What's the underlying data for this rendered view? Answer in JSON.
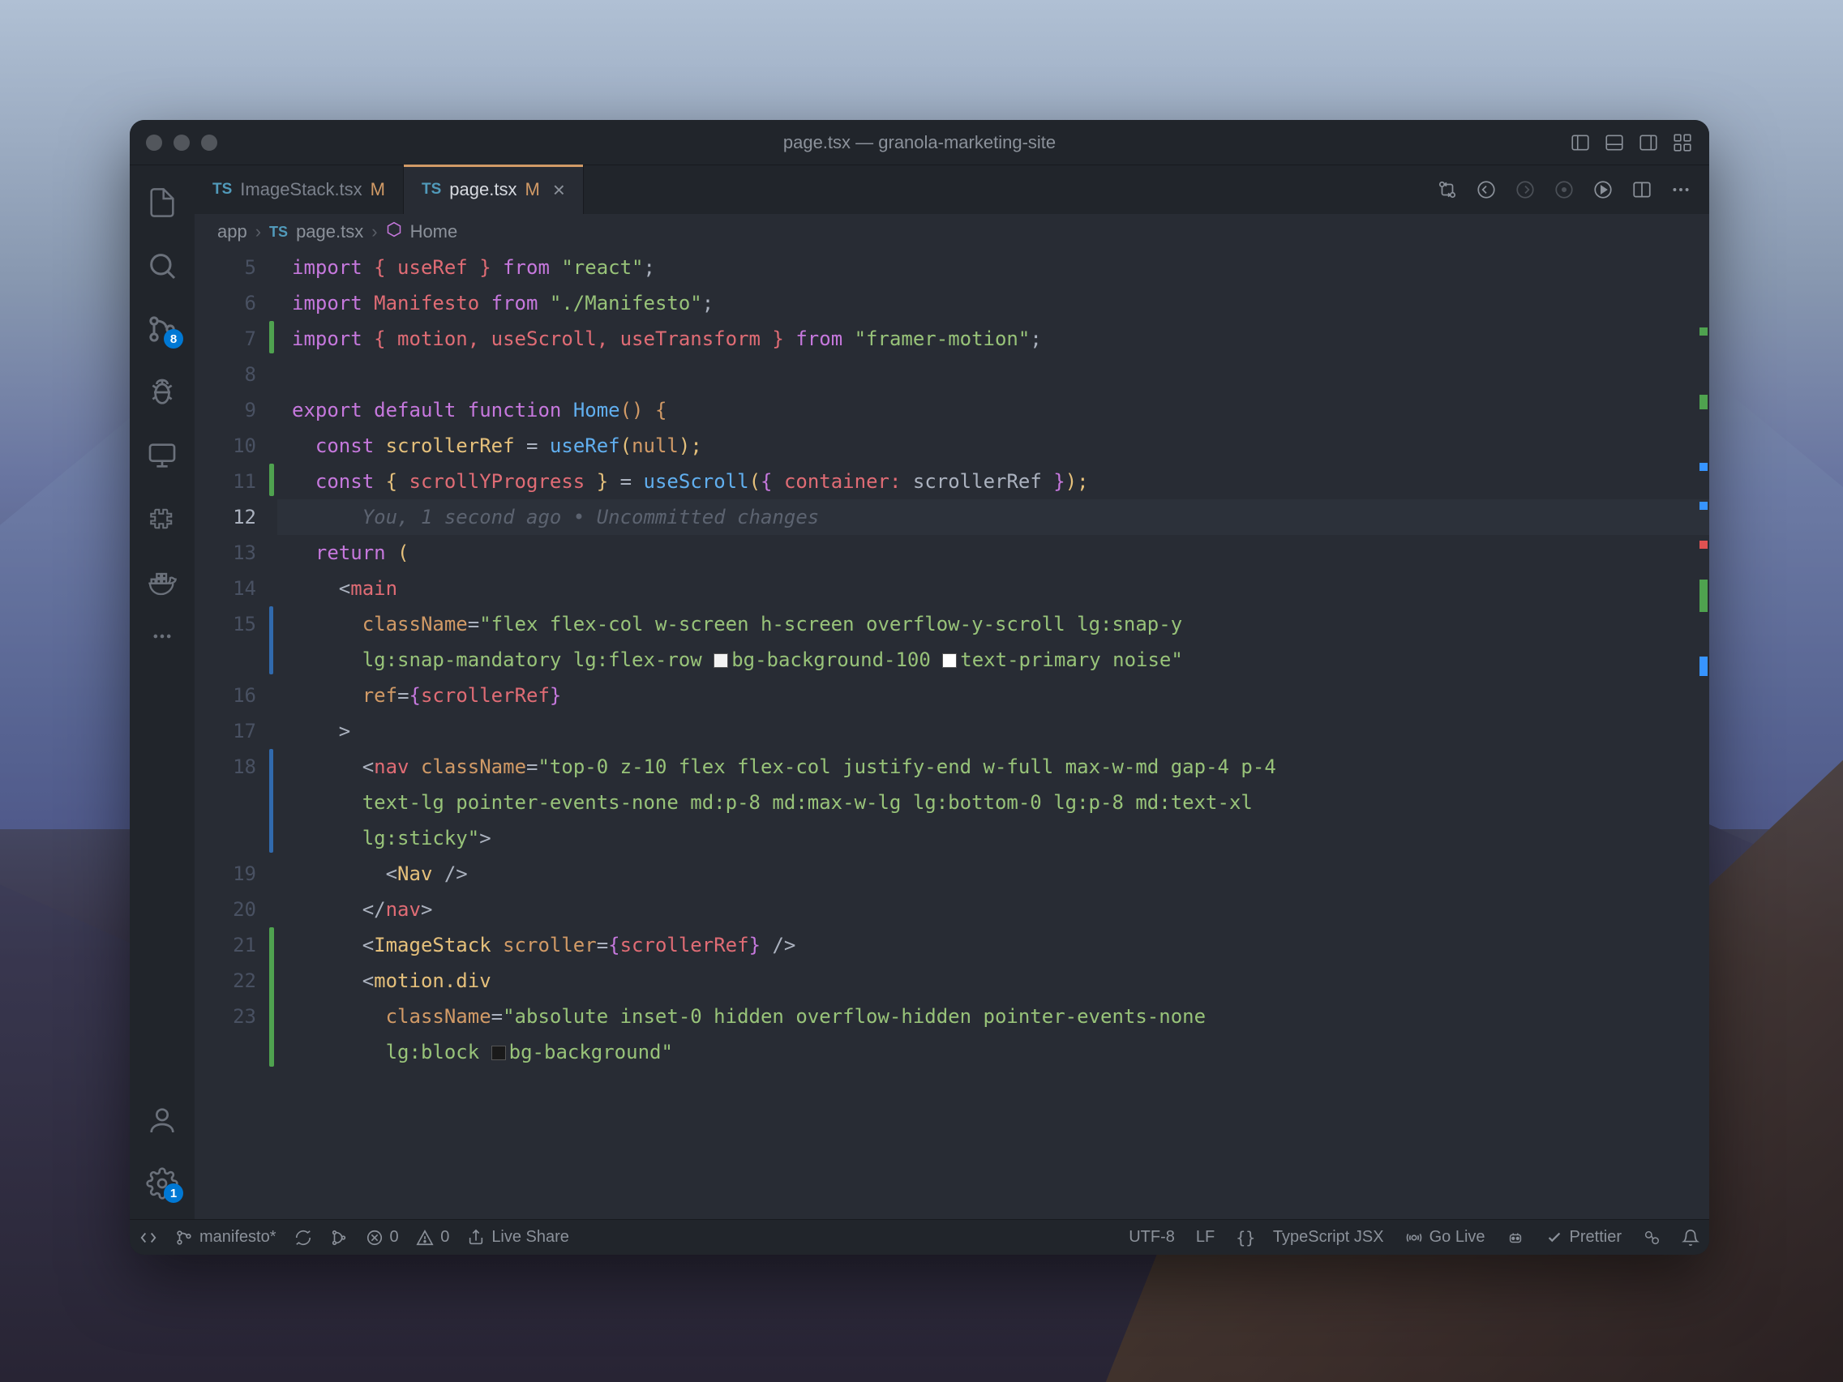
{
  "window": {
    "title": "page.tsx — granola-marketing-site"
  },
  "activity_bar": {
    "source_control_badge": "8",
    "settings_badge": "1"
  },
  "tabs": [
    {
      "icon": "TS",
      "name": "ImageStack.tsx",
      "modified": "M",
      "active": false
    },
    {
      "icon": "TS",
      "name": "page.tsx",
      "modified": "M",
      "active": true
    }
  ],
  "breadcrumb": {
    "seg1": "app",
    "seg2_icon": "TS",
    "seg2": "page.tsx",
    "seg3": "Home"
  },
  "line_numbers": [
    "5",
    "6",
    "7",
    "8",
    "9",
    "10",
    "11",
    "12",
    "13",
    "14",
    "15",
    "",
    "16",
    "17",
    "18",
    "",
    "",
    "19",
    "20",
    "21",
    "22",
    "23",
    ""
  ],
  "current_line": "12",
  "blame": "You, 1 second ago • Uncommitted changes",
  "code": {
    "l5_a": "import",
    "l5_b": "{ useRef }",
    "l5_c": "from",
    "l5_d": "\"react\"",
    "l5_e": ";",
    "l6_a": "import",
    "l6_b": "Manifesto",
    "l6_c": "from",
    "l6_d": "\"./Manifesto\"",
    "l6_e": ";",
    "l7_a": "import",
    "l7_b": "{ motion, useScroll, useTransform }",
    "l7_c": "from",
    "l7_d": "\"framer-motion\"",
    "l7_e": ";",
    "l9_a": "export",
    "l9_b": "default",
    "l9_c": "function",
    "l9_d": "Home",
    "l9_e": "()",
    "l9_f": " {",
    "l10_a": "const",
    "l10_b": "scrollerRef",
    "l10_c": " = ",
    "l10_d": "useRef",
    "l10_e": "(",
    "l10_f": "null",
    "l10_g": ");",
    "l11_a": "const",
    "l11_b": " { ",
    "l11_c": "scrollYProgress",
    "l11_d": " } ",
    "l11_e": "= ",
    "l11_f": "useScroll",
    "l11_g": "(",
    "l11_h": "{ ",
    "l11_i": "container:",
    "l11_j": " scrollerRef ",
    "l11_k": "}",
    "l11_l": ");",
    "l13_a": "return",
    "l13_b": " (",
    "l14_a": "<",
    "l14_b": "main",
    "l15_a": "className",
    "l15_b": "=",
    "l15_c": "\"flex flex-col w-screen h-screen overflow-y-scroll lg:snap-y",
    "l15w_a": "lg:snap-mandatory lg:flex-row ",
    "l15w_b": "bg-background-100 ",
    "l15w_c": "text-primary noise\"",
    "l16_a": "ref",
    "l16_b": "=",
    "l16_c": "{",
    "l16_d": "scrollerRef",
    "l16_e": "}",
    "l17_a": ">",
    "l18_a": "<",
    "l18_b": "nav",
    "l18_c": " ",
    "l18_d": "className",
    "l18_e": "=",
    "l18_f": "\"top-0 z-10 flex flex-col justify-end w-full max-w-md gap-4 p-4",
    "l18w1": "text-lg pointer-events-none md:p-8 md:max-w-lg lg:bottom-0 lg:p-8 md:text-xl",
    "l18w2": "lg:sticky\"",
    "l18w2b": ">",
    "l19_a": "<",
    "l19_b": "Nav",
    "l19_c": " />",
    "l20_a": "</",
    "l20_b": "nav",
    "l20_c": ">",
    "l21_a": "<",
    "l21_b": "ImageStack",
    "l21_c": " ",
    "l21_d": "scroller",
    "l21_e": "=",
    "l21_f": "{",
    "l21_g": "scrollerRef",
    "l21_h": "}",
    "l21_i": " />",
    "l22_a": "<",
    "l22_b": "motion.div",
    "l23_a": "className",
    "l23_b": "=",
    "l23_c": "\"absolute inset-0 hidden overflow-hidden pointer-events-none",
    "l23w_a": "lg:block ",
    "l23w_b": "bg-background\""
  },
  "status": {
    "branch": "manifesto*",
    "errors": "0",
    "warnings": "0",
    "live_share": "Live Share",
    "encoding": "UTF-8",
    "eol": "LF",
    "language": "TypeScript JSX",
    "go_live": "Go Live",
    "prettier": "Prettier"
  }
}
